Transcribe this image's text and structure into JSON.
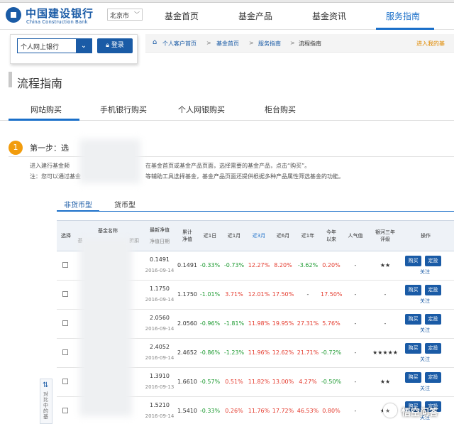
{
  "header": {
    "logo_cn": "中国建设银行",
    "logo_en": "China Construction Bank",
    "city": "北京市",
    "nav": [
      "基金首页",
      "基金产品",
      "基金资讯",
      "服务指南"
    ],
    "active_nav": "服务指南"
  },
  "login": {
    "select_value": "个人网上银行",
    "button": "登录"
  },
  "breadcrumb": {
    "items": [
      "个人客户首页",
      "基金首页",
      "服务指南",
      "流程指南"
    ],
    "separator": ">",
    "my_fund_link": "进入我的基"
  },
  "page": {
    "title": "流程指南",
    "tabs": [
      "网站购买",
      "手机银行购买",
      "个人网银购买",
      "柜台购买"
    ],
    "active_tab": "网站购买"
  },
  "step": {
    "number": "1",
    "title": "第一步：选",
    "desc1_a": "进入建行基金频",
    "desc1_b": "在基金首页或基金产品页面，选择需要的基金产品，点击“购买”。",
    "desc2_a": "注：您可以通过基金",
    "desc2_b": "等辅助工具选择基金，基金产品页面还提供根据多种产品属性筛选基金的功能。"
  },
  "fund_tabs": [
    "非货币型",
    "货币型"
  ],
  "table": {
    "headers": {
      "select": "选择",
      "name": "基金名称",
      "name_sub_a": "基",
      "name_sub_b": "折扣",
      "latest_nav": "最新净值",
      "nav_date": "净值日期",
      "cum_nav_1": "累计",
      "cum_nav_2": "净值",
      "d1": "近1日",
      "m1": "近1月",
      "m3": "近3月",
      "m6": "近6月",
      "y1": "近1年",
      "ytd_1": "今年",
      "ytd_2": "以来",
      "popularity": "人气值",
      "rating_1": "银河三年",
      "rating_2": "评级",
      "action": "操作"
    },
    "buy_label": "购买",
    "invest_label": "定投",
    "follow_label": "关注",
    "rows": [
      {
        "nav": "0.1491",
        "date": "2016-09-14",
        "cum": "0.1491",
        "d1": "-0.33%",
        "m1": "-0.73%",
        "m3": "12.27%",
        "m6": "8.20%",
        "y1": "-3.62%",
        "ytd": "0.20%",
        "pop": "-",
        "rating": "★★"
      },
      {
        "nav": "1.1750",
        "date": "2016-09-14",
        "cum": "1.1750",
        "d1": "-1.01%",
        "m1": "3.71%",
        "m3": "12.01%",
        "m6": "17.50%",
        "y1": "-",
        "ytd": "17.50%",
        "pop": "-",
        "rating": "-"
      },
      {
        "nav": "2.0560",
        "date": "2016-09-14",
        "cum": "2.0560",
        "d1": "-0.96%",
        "m1": "-1.81%",
        "m3": "11.98%",
        "m6": "19.95%",
        "y1": "27.31%",
        "ytd": "5.76%",
        "pop": "-",
        "rating": "-"
      },
      {
        "nav": "2.4052",
        "date": "2016-09-14",
        "cum": "2.4652",
        "d1": "-0.86%",
        "m1": "-1.23%",
        "m3": "11.96%",
        "m6": "12.62%",
        "y1": "21.71%",
        "ytd": "-0.72%",
        "pop": "-",
        "rating": "★★★★★"
      },
      {
        "nav": "1.3910",
        "date": "2016-09-13",
        "cum": "1.6610",
        "d1": "-0.57%",
        "m1": "0.51%",
        "m3": "11.82%",
        "m6": "13.00%",
        "y1": "4.27%",
        "ytd": "-0.50%",
        "pop": "-",
        "rating": "★★"
      },
      {
        "nav": "1.5210",
        "date": "2016-09-14",
        "cum": "1.5410",
        "d1": "-0.33%",
        "m1": "0.26%",
        "m3": "11.76%",
        "m6": "17.72%",
        "y1": "46.53%",
        "ytd": "0.80%",
        "pop": "-",
        "rating": "★★"
      }
    ]
  },
  "side_compare": {
    "icon": "⇅",
    "text": "对比中的基"
  },
  "watermark": "悟空问答",
  "colors": {
    "brand": "#1a5ba6",
    "accent": "#1a6fc9",
    "positive": "#e43b2e",
    "negative": "#1c9a30",
    "step_badge": "#f29c0c"
  }
}
